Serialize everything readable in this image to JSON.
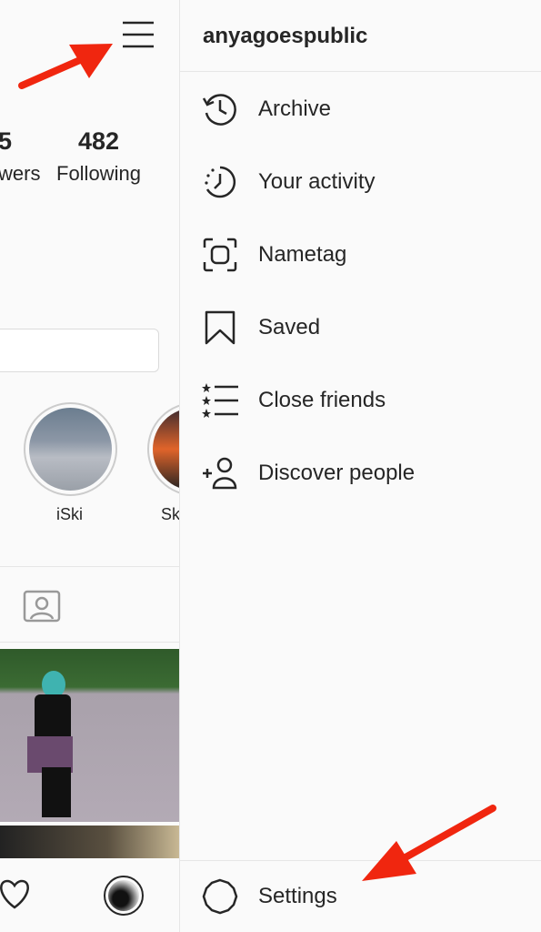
{
  "profile": {
    "followers_count_partial": "5",
    "followers_label_partial": "wers",
    "following_count": "482",
    "following_label": "Following",
    "highlights": [
      {
        "label": "iSki"
      },
      {
        "label": "Sk"
      }
    ]
  },
  "drawer": {
    "username": "anyagoespublic",
    "items": [
      {
        "label": "Archive",
        "icon": "archive-icon"
      },
      {
        "label": "Your activity",
        "icon": "activity-icon"
      },
      {
        "label": "Nametag",
        "icon": "nametag-icon"
      },
      {
        "label": "Saved",
        "icon": "bookmark-icon"
      },
      {
        "label": "Close friends",
        "icon": "close-friends-icon"
      },
      {
        "label": "Discover people",
        "icon": "add-person-icon"
      }
    ],
    "settings_label": "Settings"
  },
  "colors": {
    "annotation_arrow": "#f0260f",
    "text": "#262626",
    "divider": "#e6e6e6"
  }
}
